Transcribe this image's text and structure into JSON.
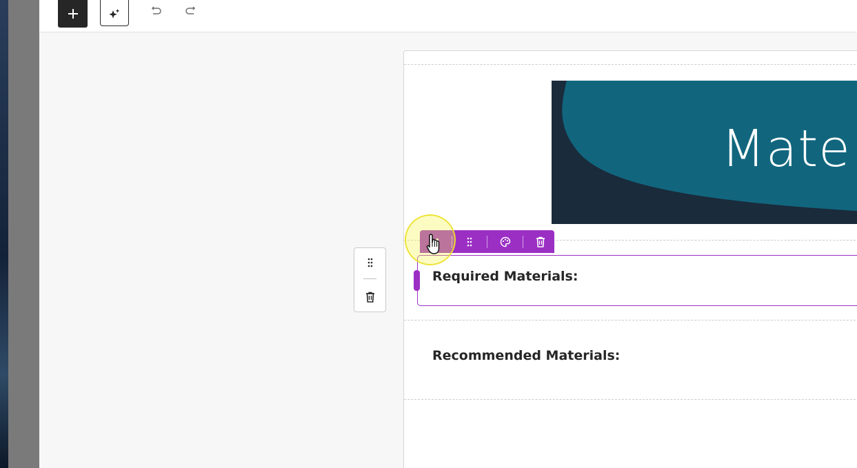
{
  "toolbar": {
    "add_icon": "plus-icon",
    "ai_icon": "sparkle-icon",
    "undo_icon": "undo-icon",
    "redo_icon": "redo-icon"
  },
  "row_controls": {
    "drag_icon": "drag-handle-icon",
    "delete_icon": "trash-icon"
  },
  "block_toolbar": {
    "edit_icon": "pencil-icon",
    "drag_icon": "drag-handle-icon",
    "style_icon": "palette-icon",
    "delete_icon": "trash-icon",
    "color": "#9b2fc4"
  },
  "banner": {
    "title": "Mate",
    "colors": {
      "dark": "#1a2b3c",
      "teal": "#11667e"
    }
  },
  "content": {
    "required_heading": "Required Materials:",
    "recommended_heading": "Recommended Materials:"
  }
}
